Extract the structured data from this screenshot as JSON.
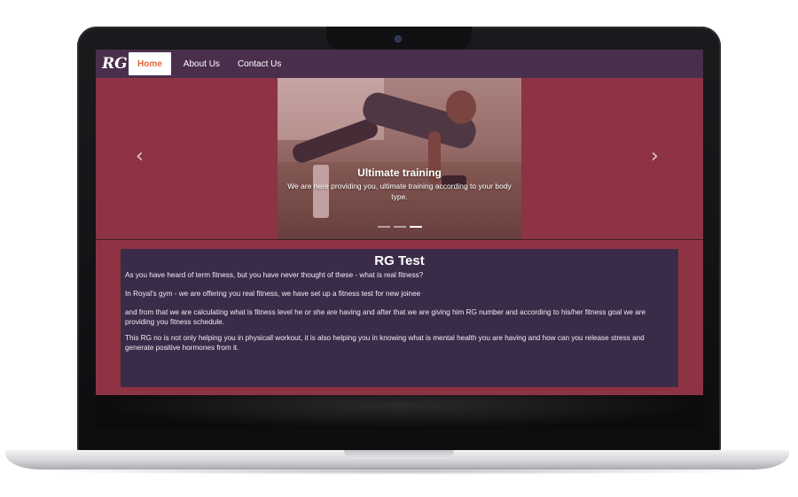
{
  "navbar": {
    "brand": "RG",
    "items": [
      {
        "label": "Home",
        "active": true
      },
      {
        "label": "About Us",
        "active": false
      },
      {
        "label": "Contact Us",
        "active": false
      }
    ]
  },
  "carousel": {
    "caption_title": "Ultimate training",
    "caption_text": "We are here providing you, ultimate training according to your body type.",
    "slides_count": 3,
    "active_slide": 3,
    "prev_icon": "chevron-left-icon",
    "next_icon": "chevron-right-icon"
  },
  "section": {
    "title": "RG Test",
    "paragraphs": [
      "As you have heard of term fitness, but you have never thought of these - what is real fitness?",
      "In Royal's gym - we are offering you real fitness, we have set up a fitness test for new joinee",
      "and from that we are calculating what is fitness level he or she are having and after that we are giving him RG number and according to his/her fitness goal we are providing you fitness schedule.",
      "This RG no is not only helping you in physicall workout, it is also helping you in knowing what is mental health you are having and how can you release stress and generate positive hormones from it."
    ]
  },
  "colors": {
    "navbar_bg": "#4a2f4d",
    "page_bg": "#8e3343",
    "card_bg": "#3a2b49",
    "active_nav_text": "#e0663a"
  }
}
